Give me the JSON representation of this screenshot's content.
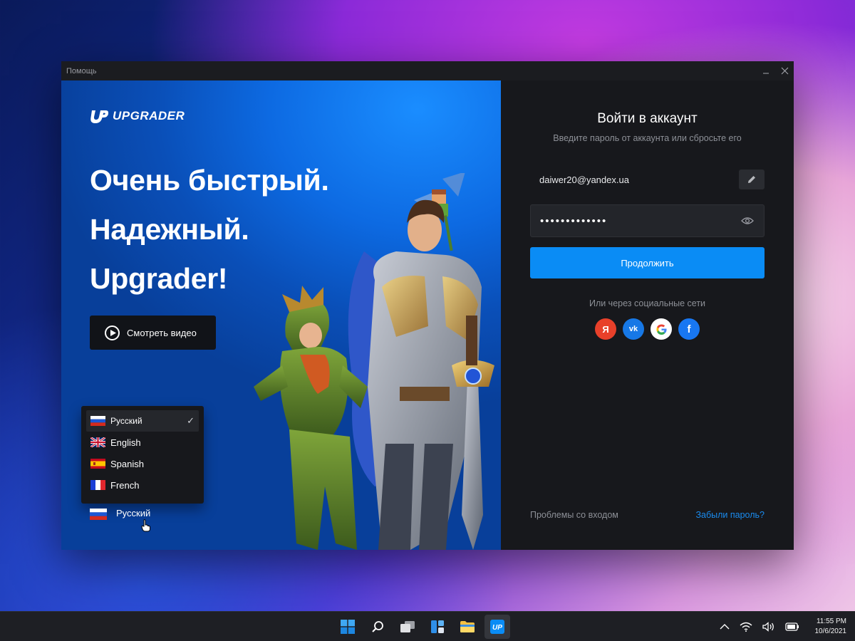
{
  "window": {
    "title": "Помощь"
  },
  "hero": {
    "logo_text": "UPGRADER",
    "headline": [
      "Очень быстрый.",
      "Надежный.",
      "Upgrader!"
    ],
    "video_button": "Смотреть видео"
  },
  "language": {
    "options": [
      {
        "label": "Русский",
        "flag": "ru",
        "selected": true
      },
      {
        "label": "English",
        "flag": "uk",
        "selected": false
      },
      {
        "label": "Spanish",
        "flag": "es",
        "selected": false
      },
      {
        "label": "French",
        "flag": "fr",
        "selected": false
      }
    ],
    "current": "Русский",
    "check_mark": "✓"
  },
  "login": {
    "title": "Войти в аккаунт",
    "subtitle": "Введите пароль от аккаунта или сбросьте его",
    "email": "daiwer20@yandex.ua",
    "password_masked": "•••••••••••••",
    "continue_button": "Продолжить",
    "social_label": "Или через социальные сети",
    "socials": [
      {
        "name": "yandex",
        "glyph": "Я",
        "color": "#e8402a"
      },
      {
        "name": "vk",
        "glyph": "vk",
        "color": "#1778e6"
      },
      {
        "name": "google",
        "glyph": "G",
        "color": "#ffffff"
      },
      {
        "name": "facebook",
        "glyph": "f",
        "color": "#1877f2"
      }
    ],
    "trouble_link": "Проблемы со входом",
    "forgot_link": "Забыли пароль?"
  },
  "taskbar": {
    "time": "11:55 PM",
    "date": "10/6/2021",
    "apps": [
      "start-icon",
      "search-icon",
      "task-view-icon",
      "widgets-icon",
      "file-explorer-icon",
      "upgrader-app-icon"
    ]
  },
  "colors": {
    "accent": "#0a8cf5",
    "link": "#1a8cf0",
    "panel_bg": "#17181c"
  }
}
